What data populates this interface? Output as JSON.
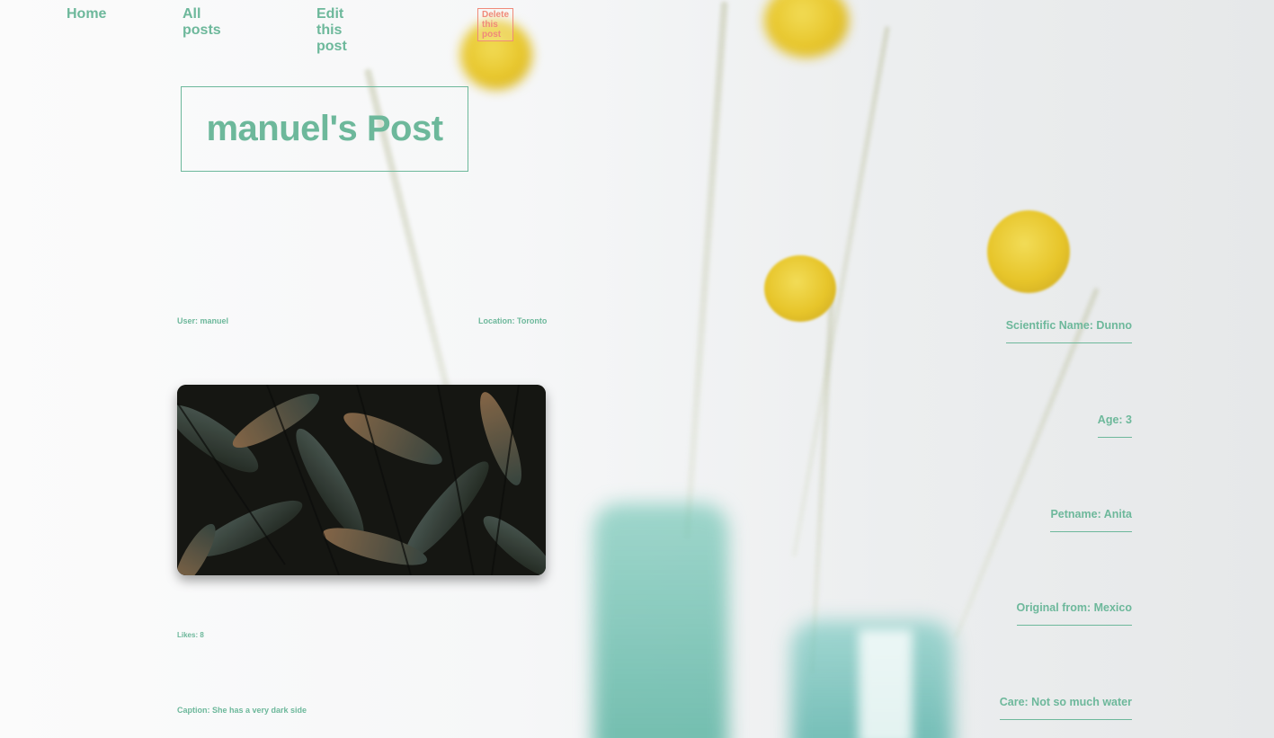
{
  "nav": {
    "home": "Home",
    "all_posts": "All posts",
    "edit_post": "Edit this post",
    "delete_post": "Delete this post"
  },
  "post": {
    "title": "manuel's Post",
    "user": "User: manuel",
    "location": "Location: Toronto",
    "likes": "Likes: 8",
    "caption": "Caption: She has a very dark side"
  },
  "plant_details": [
    "Scientific Name: Dunno",
    "Age: 3",
    "Petname: Anita",
    "Original from: Mexico",
    "Care: Not so much water"
  ],
  "colors": {
    "accent": "#6db89b",
    "danger": "#f08a7a"
  }
}
